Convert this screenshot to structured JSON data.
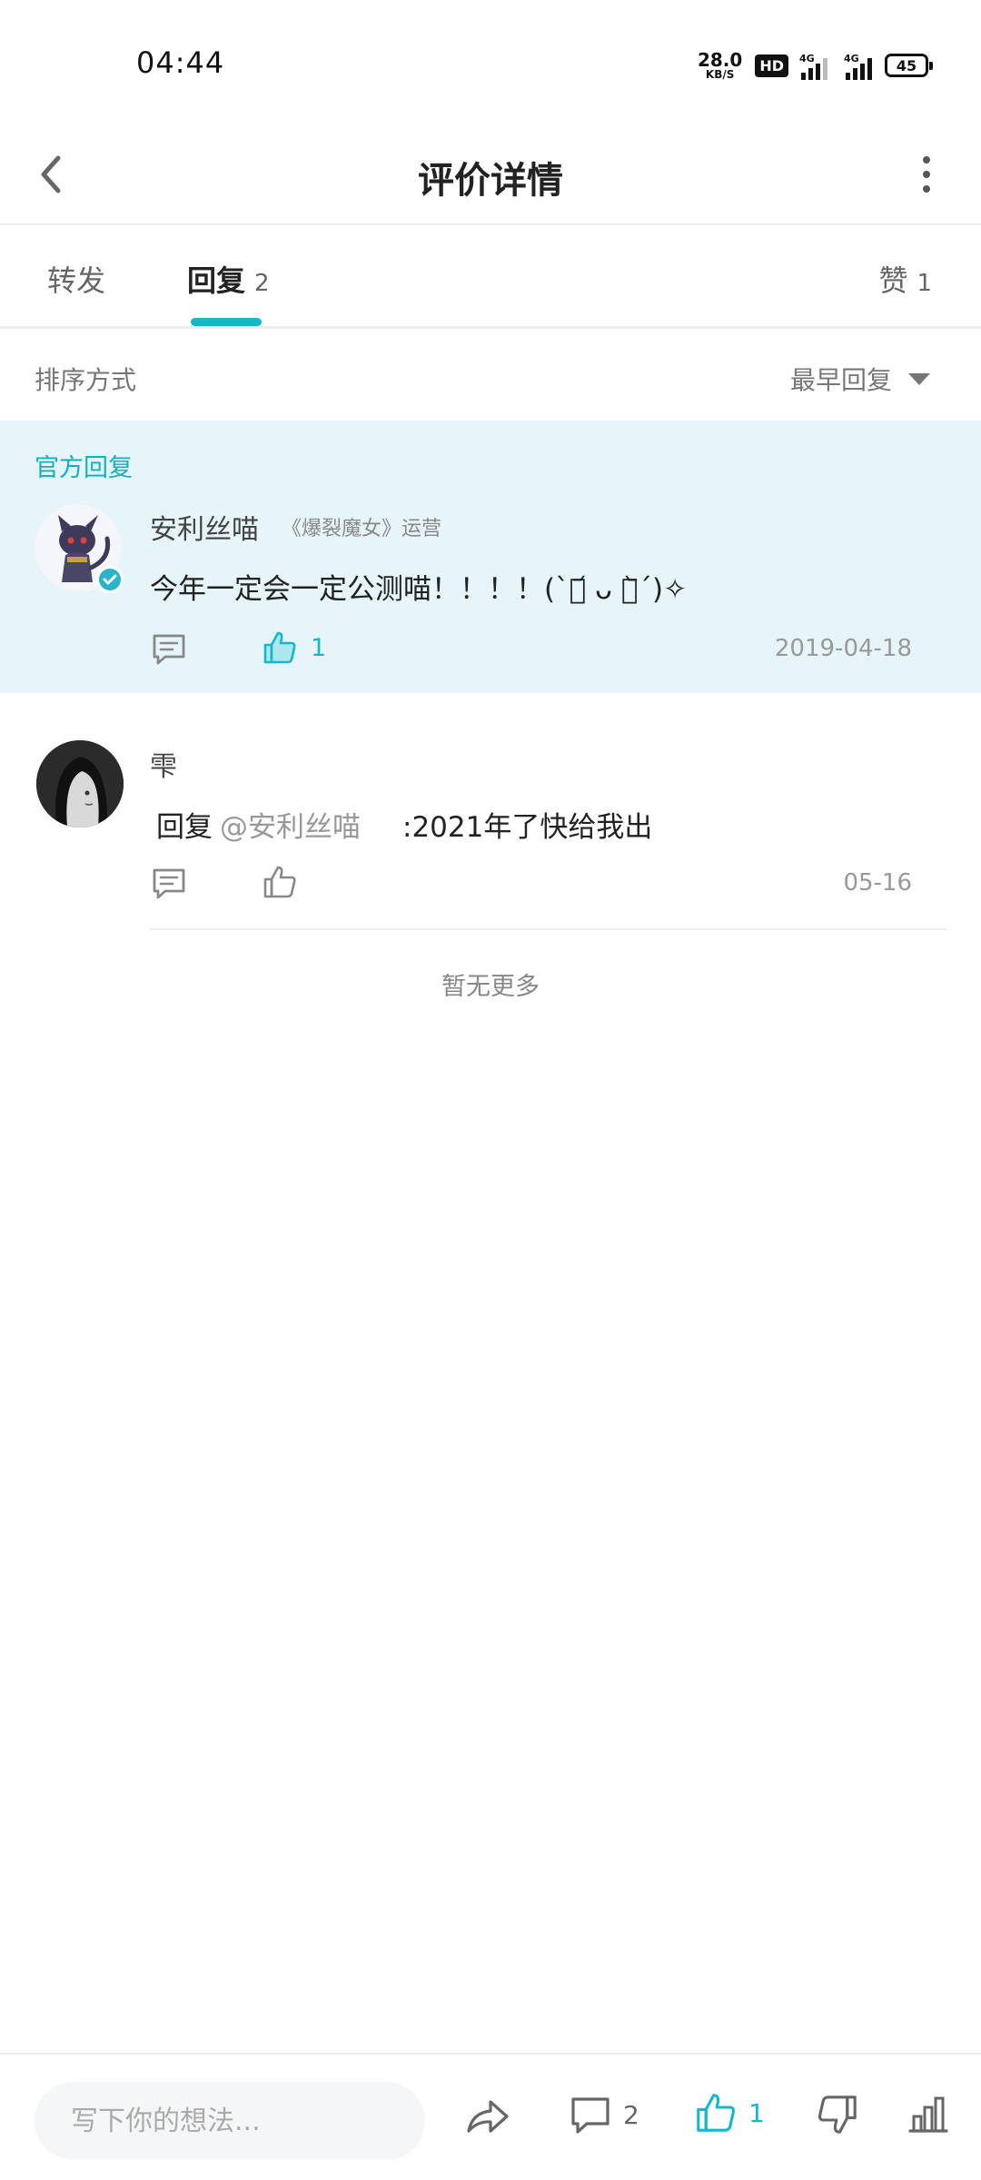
{
  "status_bar": {
    "time": "04:44",
    "net_speed_value": "28.0",
    "net_speed_unit": "KB/S",
    "hd_label": "HD",
    "sim1_label": "4G",
    "sim2_label": "4G",
    "battery": "45"
  },
  "header": {
    "title": "评价详情"
  },
  "tabs": [
    {
      "label": "转发",
      "count": ""
    },
    {
      "label": "回复",
      "count": "2"
    },
    {
      "label": "赞",
      "count": "1"
    }
  ],
  "sort": {
    "label": "排序方式",
    "selected": "最早回复"
  },
  "official_reply": {
    "section_label": "官方回复",
    "username": "安利丝喵",
    "tag": "《爆裂魔女》运营",
    "content": "今年一定会一定公测喵！！！！(ง •̀_•́)ง✧",
    "content_display": "今年一定会一定公测喵！！！！(`･᷄ ᴗ ･᷅´)✧",
    "like_count": "1",
    "date": "2019-04-18"
  },
  "replies": [
    {
      "username": "雫",
      "reply_prefix": "回复",
      "mention": "@安利丝喵",
      "content": ":2021年了快给我出",
      "date": "05-16"
    }
  ],
  "footer_note": "暂无更多",
  "bottom_bar": {
    "input_placeholder": "写下你的想法...",
    "comment_count": "2",
    "like_count": "1"
  },
  "colors": {
    "accent": "#14b9c8",
    "official_bg": "#e5f5f9"
  }
}
